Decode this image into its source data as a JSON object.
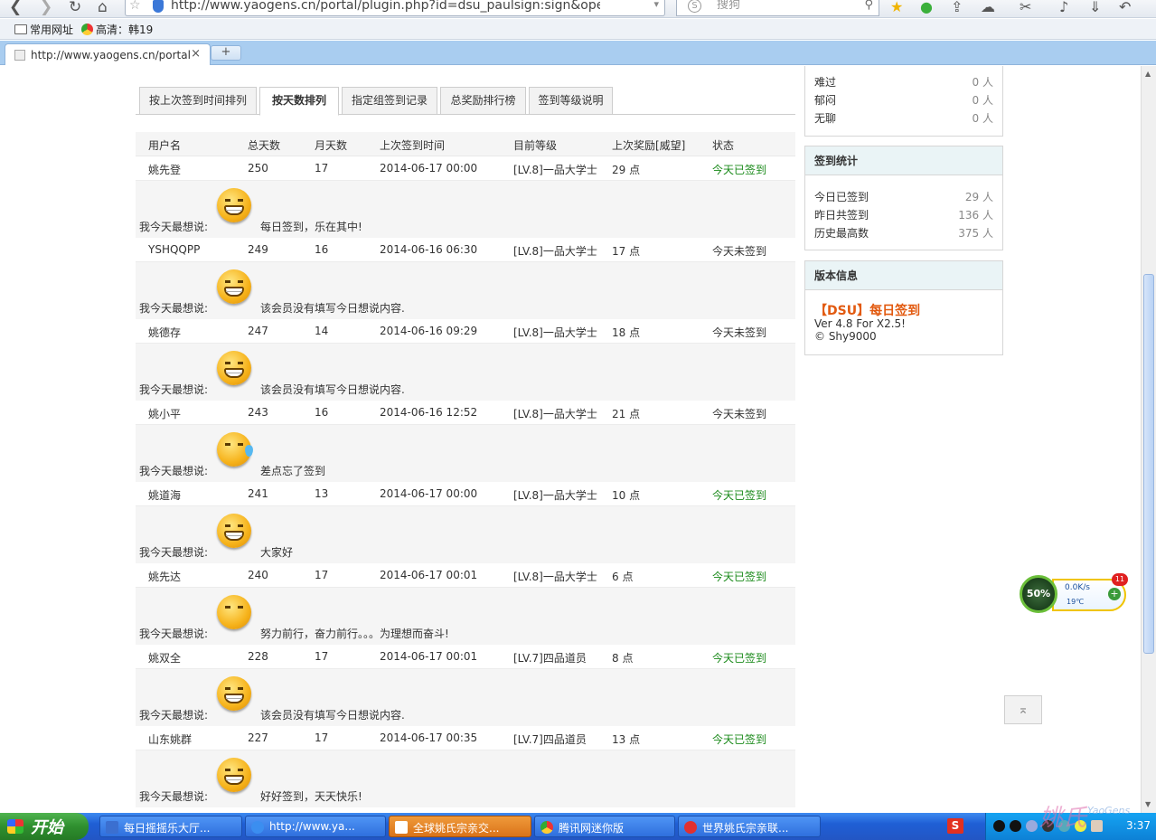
{
  "browser": {
    "url": "http://www.yaogens.cn/portal/plugin.php?id=dsu_paulsign:sign&operation",
    "search_placeholder": "搜狗",
    "search_engine_glyph": "S",
    "bookmarks": [
      {
        "label": "常用网址"
      },
      {
        "label": "高清：韩19"
      }
    ],
    "tab_title": "http://www.yaogens.cn/portal/plu",
    "tab_close": "×",
    "new_tab": "+"
  },
  "page": {
    "tabs": [
      {
        "label": "按上次签到时间排列",
        "active": false
      },
      {
        "label": "按天数排列",
        "active": true
      },
      {
        "label": "指定组签到记录",
        "active": false
      },
      {
        "label": "总奖励排行榜",
        "active": false
      },
      {
        "label": "签到等级说明",
        "active": false
      }
    ],
    "table": {
      "headers": [
        "用户名",
        "总天数",
        "月天数",
        "上次签到时间",
        "目前等级",
        "上次奖励[威望]",
        "状态"
      ],
      "say_label": "我今天最想说:",
      "rows": [
        {
          "user": "姚先登",
          "total": "250",
          "month": "17",
          "last": "2014-06-17 00:00",
          "level": "[LV.8]一品大学士",
          "reward": "29 点",
          "status": "今天已签到",
          "message": "每日签到，乐在其中!"
        },
        {
          "user": "YSHQQPP",
          "total": "249",
          "month": "16",
          "last": "2014-06-16 06:30",
          "level": "[LV.8]一品大学士",
          "reward": "17 点",
          "status": "今天未签到",
          "message": "该会员没有填写今日想说内容."
        },
        {
          "user": "姚德存",
          "total": "247",
          "month": "14",
          "last": "2014-06-16 09:29",
          "level": "[LV.8]一品大学士",
          "reward": "18 点",
          "status": "今天未签到",
          "message": "该会员没有填写今日想说内容."
        },
        {
          "user": "姚小平",
          "total": "243",
          "month": "16",
          "last": "2014-06-16 12:52",
          "level": "[LV.8]一品大学士",
          "reward": "21 点",
          "status": "今天未签到",
          "message": "差点忘了签到"
        },
        {
          "user": "姚道海",
          "total": "241",
          "month": "13",
          "last": "2014-06-17 00:00",
          "level": "[LV.8]一品大学士",
          "reward": "10 点",
          "status": "今天已签到",
          "message": "大家好"
        },
        {
          "user": "姚先达",
          "total": "240",
          "month": "17",
          "last": "2014-06-17 00:01",
          "level": "[LV.8]一品大学士",
          "reward": "6 点",
          "status": "今天已签到",
          "message": "努力前行，奋力前行。。。为理想而奋斗!"
        },
        {
          "user": "姚双全",
          "total": "228",
          "month": "17",
          "last": "2014-06-17 00:01",
          "level": "[LV.7]四品道员",
          "reward": "8 点",
          "status": "今天已签到",
          "message": "该会员没有填写今日想说内容."
        },
        {
          "user": "山东姚群",
          "total": "227",
          "month": "17",
          "last": "2014-06-17 00:35",
          "level": "[LV.7]四品道员",
          "reward": "13 点",
          "status": "今天已签到",
          "message": "好好签到，天天快乐!"
        }
      ]
    },
    "sidebar": {
      "mood": [
        {
          "label": "难过",
          "value": "0 人"
        },
        {
          "label": "郁闷",
          "value": "0 人"
        },
        {
          "label": "无聊",
          "value": "0 人"
        }
      ],
      "stats_title": "签到统计",
      "stats": [
        {
          "label": "今日已签到",
          "value": "29 人"
        },
        {
          "label": "昨日共签到",
          "value": "136 人"
        },
        {
          "label": "历史最高数",
          "value": "375 人"
        }
      ],
      "version_title": "版本信息",
      "version_name": "【DSU】每日签到",
      "version_line1": "Ver 4.8 For X2.5!",
      "version_line2": "© Shy9000"
    },
    "widget": {
      "percent": "50%",
      "speed": "0.0K/s",
      "temp": "19℃",
      "badge": "11"
    },
    "totop": "⌅"
  },
  "taskbar": {
    "start": "开始",
    "tasks": [
      {
        "label": "每日摇摇乐大厅...",
        "color": "#3b6fd0"
      },
      {
        "label": "http://www.ya...",
        "color": "#3b8ef0"
      },
      {
        "label": "全球姚氏宗亲交...",
        "color": "#f0a030"
      },
      {
        "label": "腾讯网迷你版",
        "color": "#3b8ef0"
      },
      {
        "label": "世界姚氏宗亲联...",
        "color": "#e03030"
      }
    ],
    "sogou": "S",
    "clock": "3:37"
  },
  "watermark": {
    "text": "姚氏",
    "sub": "YaoGens"
  },
  "colors": {
    "done": "#1a8a1a",
    "accent": "#e25a10",
    "taskbar": "#2356c4"
  }
}
